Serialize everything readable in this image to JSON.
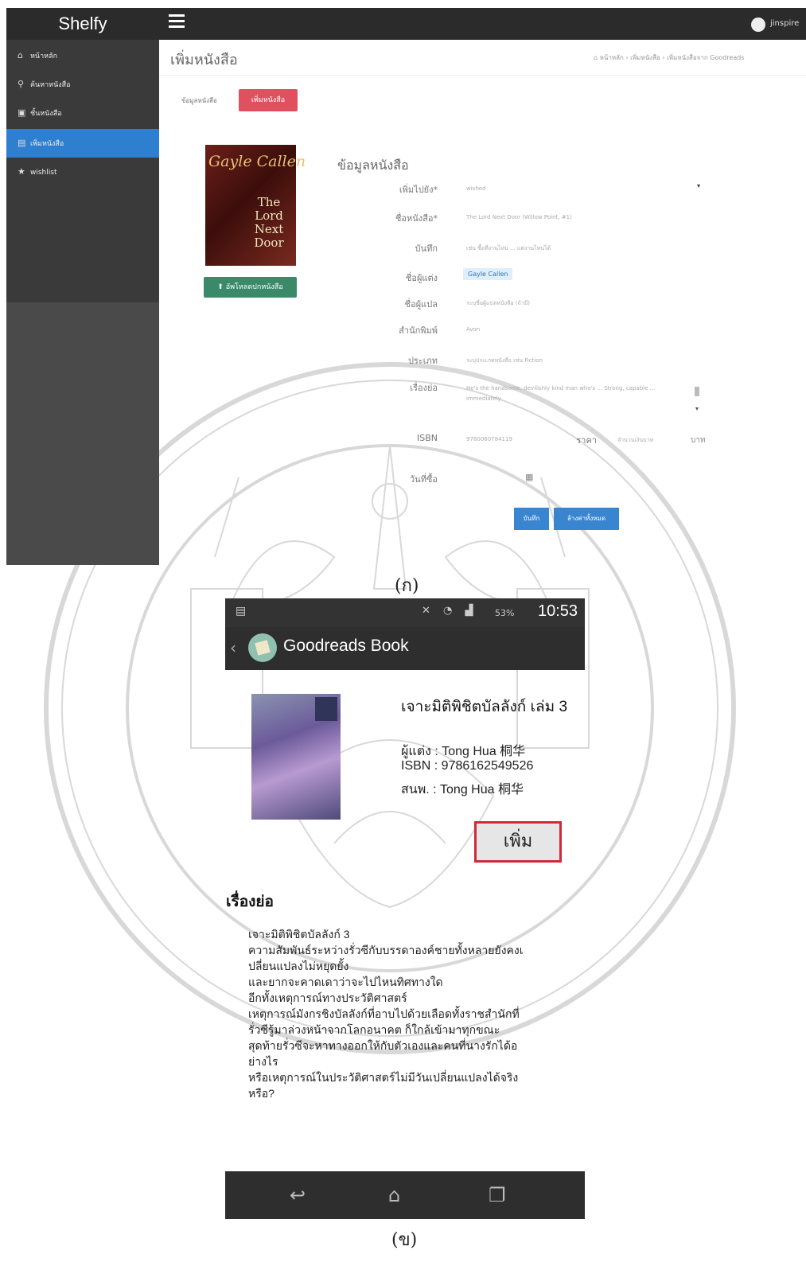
{
  "web": {
    "brand": "Shelfy",
    "user": "jinspire",
    "sidebar": [
      {
        "icon": "home-icon",
        "glyph": "⌂",
        "label": "หน้าหลัก"
      },
      {
        "icon": "search-icon",
        "glyph": "⚲",
        "label": "ค้นหาหนังสือ"
      },
      {
        "icon": "box-icon",
        "glyph": "▣",
        "label": "ชั้นหนังสือ"
      },
      {
        "icon": "book-icon",
        "glyph": "▤",
        "label": "เพิ่มหนังสือ"
      },
      {
        "icon": "star-icon",
        "glyph": "★",
        "label": "wishlist"
      }
    ],
    "page_title": "เพิ่มหนังสือ",
    "breadcrumb": "⌂ หน้าหลัก  ›  เพิ่มหนังสือ  ›  เพิ่มหนังสือจาก Goodreads",
    "tabs": {
      "info": "ข้อมูลหนังสือ",
      "add": "เพิ่มหนังสือ"
    },
    "cover": {
      "author": "Gayle Callen",
      "title": "The Lord Next Door"
    },
    "upload_label": "⬆ อัพโหลดปกหนังสือ",
    "form_title": "ข้อมูลหนังสือ",
    "fields": [
      {
        "label": "เพิ่มไปยัง*",
        "value": "wished"
      },
      {
        "label": "ชื่อหนังสือ*",
        "value": "The Lord Next Door (Willow Point, #1)"
      },
      {
        "label": "บันทึก",
        "value": "เช่น ซื้อที่งานไหน ... แต่งานไหนได้"
      },
      {
        "label": "ชื่อผู้แต่ง",
        "value": "Gayle Callen"
      },
      {
        "label": "ชื่อผู้แปล",
        "value": "ระบุชื่อผู้แปลหนังสือ (ถ้ามี)"
      },
      {
        "label": "สำนักพิมพ์",
        "value": "Avon"
      },
      {
        "label": "ประเภท",
        "value": "ระบุประเภทหนังสือ เช่น Fiction"
      },
      {
        "label": "เรื่องย่อ",
        "value": "He's the handsome, devilishly kind man who's ... Strong, capable ... immediately"
      },
      {
        "label": "ISBN",
        "value": "9780060784119"
      },
      {
        "label": "วันที่ซื้อ",
        "value": ""
      }
    ],
    "price_label": "ราคา",
    "price_placeholder": "จำนวนเงินบาท",
    "currency": "บาท",
    "buttons": {
      "save": "บันทึก",
      "clear": "ล้างค่าทั้งหมด"
    },
    "caption": "(ก)"
  },
  "mobile": {
    "status_time": "10:53",
    "battery": "53%",
    "app_title": "Goodreads Book",
    "book_title": "เจาะมิติพิชิตบัลลังก์ เล่ม 3",
    "author": "ผู้แต่ง : Tong Hua 桐华",
    "isbn": "ISBN : 9786162549526",
    "publisher": "สนพ. : Tong Hua 桐华",
    "add_button": "เพิ่ม",
    "story_heading": "เรื่องย่อ",
    "story_lines": [
      "เจาะมิติพิชิตบัลลังก์ 3",
      "ความสัมพันธ์ระหว่างรั่วซีกับบรรดาองค์ชายทั้งหลายยังคงเ",
      "ปลี่ยนแปลงไม่หยุดยั้ง",
      "และยากจะคาดเดาว่าจะไปไหนทิศทางใด",
      "อีกทั้งเหตุการณ์ทางประวัติศาสตร์",
      "เหตุการณ์มังกรชิงบัลลังก์ที่อาบไปด้วยเลือดทั้งราชสำนักที่",
      "รั่วซีรู้มาล่วงหน้าจากโลกอนาคต ก็ใกล้เข้ามาทุกขณะ",
      "สุดท้ายรั่วซีจะหาทางออกให้กับตัวเองและคนที่นางรักได้อ",
      "ย่างไร",
      "หรือเหตุการณ์ในประวัติศาสตร์ไม่มีวันเปลี่ยนแปลงได้จริง",
      "หรือ?"
    ],
    "caption": "(ข)"
  },
  "colors": {
    "accent_red": "#e0505f",
    "active_blue": "#2f7fd0",
    "upload_green": "#3a8a6a"
  }
}
